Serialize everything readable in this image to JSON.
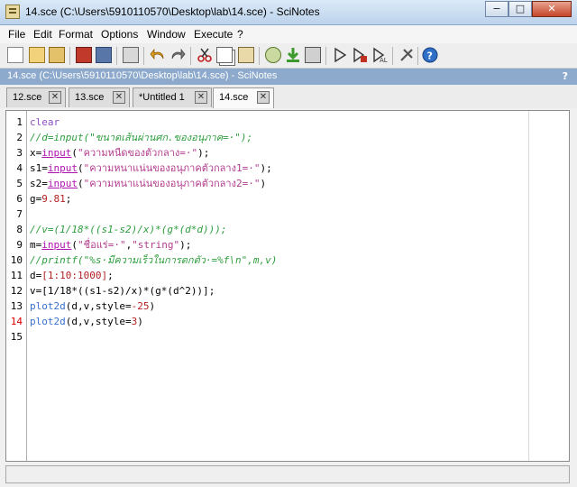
{
  "window": {
    "title": "14.sce (C:\\Users\\5910110570\\Desktop\\lab\\14.sce) - SciNotes",
    "minimize": "−",
    "maximize": "□",
    "close": "✕"
  },
  "menu": [
    "File",
    "Edit",
    "Format",
    "Options",
    "Window",
    "Execute",
    "?"
  ],
  "toolbar_icons": [
    "new-file-icon",
    "open-file-icon",
    "open-folder-icon",
    "save-icon",
    "save-as-icon",
    "print-icon",
    "undo-icon",
    "redo-icon",
    "cut-icon",
    "copy-icon",
    "paste-icon",
    "find-replace-icon",
    "execute-icon",
    "load-into-scilab-icon",
    "run-icon",
    "step-icon",
    "stop-icon",
    "variable-browser-icon",
    "help-icon"
  ],
  "path_bar": {
    "text": "14.sce (C:\\Users\\5910110570\\Desktop\\lab\\14.sce) - SciNotes",
    "help": "?"
  },
  "tabs": [
    {
      "label": "12.sce",
      "close": "✕",
      "active": false
    },
    {
      "label": "13.sce",
      "close": "✕",
      "active": false
    },
    {
      "label": "*Untitled 1",
      "close": "✕",
      "active": false
    },
    {
      "label": "14.sce",
      "close": "✕",
      "active": true
    }
  ],
  "editor": {
    "line_numbers": [
      "1",
      "2",
      "3",
      "4",
      "5",
      "6",
      "7",
      "8",
      "9",
      "10",
      "11",
      "12",
      "13",
      "14",
      "15"
    ],
    "error_lines": [
      "14"
    ],
    "lines": [
      [
        {
          "t": "clear",
          "c": "kw"
        }
      ],
      [
        {
          "t": "//d=input(\"ขนาดเส้นผ่านศก.ของอนุภาค=·\");",
          "c": "cm"
        }
      ],
      [
        {
          "t": "x=",
          "c": "plain"
        },
        {
          "t": "input",
          "c": "fn"
        },
        {
          "t": "(",
          "c": "plain"
        },
        {
          "t": "\"ความหนืดของตัวกลาง=·\"",
          "c": "str"
        },
        {
          "t": ");",
          "c": "plain"
        }
      ],
      [
        {
          "t": "s1=",
          "c": "plain"
        },
        {
          "t": "input",
          "c": "fn"
        },
        {
          "t": "(",
          "c": "plain"
        },
        {
          "t": "\"ความหนาแน่นของอนุภาคตัวกลาง1=·\"",
          "c": "str"
        },
        {
          "t": ");",
          "c": "plain"
        }
      ],
      [
        {
          "t": "s2=",
          "c": "plain"
        },
        {
          "t": "input",
          "c": "fn"
        },
        {
          "t": "(",
          "c": "plain"
        },
        {
          "t": "\"ความหนาแน่นของอนุภาคตัวกลาง2=·\"",
          "c": "str"
        },
        {
          "t": ")",
          "c": "plain"
        }
      ],
      [
        {
          "t": "g=",
          "c": "plain"
        },
        {
          "t": "9.81",
          "c": "num"
        },
        {
          "t": ";",
          "c": "plain"
        }
      ],
      [],
      [
        {
          "t": "//v=(1/18*((s1-s2)/x)*(g*(d*d)));",
          "c": "cm"
        }
      ],
      [
        {
          "t": "m=",
          "c": "plain"
        },
        {
          "t": "input",
          "c": "fn"
        },
        {
          "t": "(",
          "c": "plain"
        },
        {
          "t": "\"ชื่อแร่=·\"",
          "c": "str"
        },
        {
          "t": ",",
          "c": "plain"
        },
        {
          "t": "\"string\"",
          "c": "str"
        },
        {
          "t": ");",
          "c": "plain"
        }
      ],
      [
        {
          "t": "//printf(\"%s·มีความเร็วในการตกตัว·=%f\\n\",m,v)",
          "c": "cm"
        }
      ],
      [
        {
          "t": "d=",
          "c": "plain"
        },
        {
          "t": "[1:10:1000]",
          "c": "num"
        },
        {
          "t": ";",
          "c": "plain"
        }
      ],
      [
        {
          "t": "v=",
          "c": "plain"
        },
        {
          "t": "[1/18*((s1-s2)/x)*(g*(d^2))]",
          "c": "plain"
        },
        {
          "t": ";",
          "c": "plain"
        }
      ],
      [
        {
          "t": "plot2d",
          "c": "fn2"
        },
        {
          "t": "(d,v,style=",
          "c": "plain"
        },
        {
          "t": "-25",
          "c": "num"
        },
        {
          "t": ")",
          "c": "plain"
        }
      ],
      [
        {
          "t": "plot2d",
          "c": "fn2"
        },
        {
          "t": "(d,v,style=",
          "c": "plain"
        },
        {
          "t": "3",
          "c": "num"
        },
        {
          "t": ")",
          "c": "plain"
        }
      ],
      []
    ]
  },
  "colors": {
    "path_bar": "#8da9cc",
    "comment": "#2e9e3e",
    "keyword": "#8f4ec4",
    "function": "#b012b0",
    "string": "#b33c8e",
    "number": "#b22222"
  }
}
